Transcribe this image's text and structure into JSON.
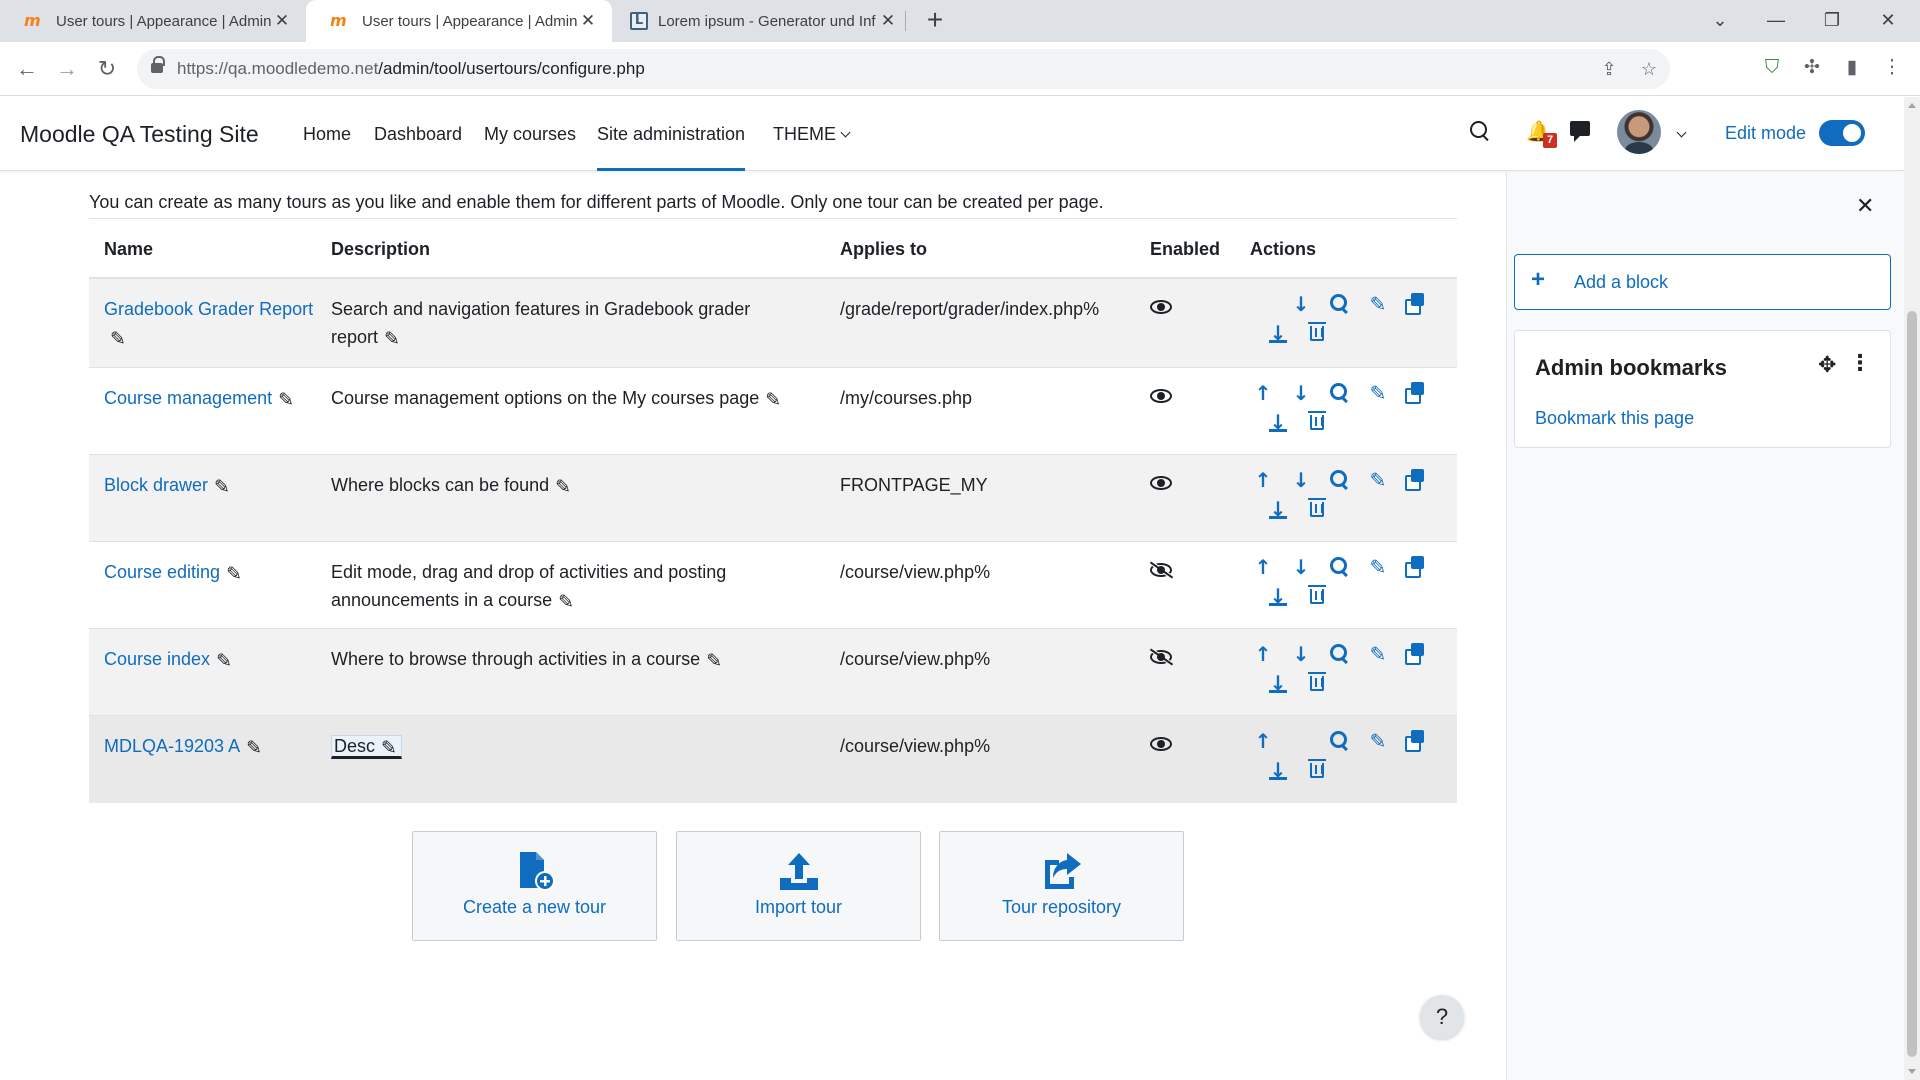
{
  "browser": {
    "tabs": [
      {
        "title": "User tours | Appearance | Admini",
        "favicon": "moodle-icon"
      },
      {
        "title": "User tours | Appearance | Admini",
        "favicon": "moodle-icon"
      },
      {
        "title": "Lorem ipsum - Generator und Inf",
        "favicon": "lorem-icon"
      }
    ],
    "url_host": "https://qa.moodledemo.net",
    "url_path": "/admin/tool/usertours/configure.php"
  },
  "navbar": {
    "site_name": "Moodle QA Testing Site",
    "items": [
      "Home",
      "Dashboard",
      "My courses",
      "Site administration",
      "THEME"
    ],
    "notification_count": "7",
    "edit_mode_label": "Edit mode"
  },
  "main": {
    "intro": "You can create as many tours as you like and enable them for different parts of Moodle. Only one tour can be created per page.",
    "columns": [
      "Name",
      "Description",
      "Applies to",
      "Enabled",
      "Actions"
    ],
    "tours": [
      {
        "name": "Gradebook Grader Report",
        "description": "Search and navigation features in Gradebook grader report",
        "applies_to": "/grade/report/grader/index.php%",
        "enabled": true
      },
      {
        "name": "Course management",
        "description": "Course management options on the My courses page",
        "applies_to": "/my/courses.php",
        "enabled": true
      },
      {
        "name": "Block drawer",
        "description": "Where blocks can be found",
        "applies_to": "FRONTPAGE_MY",
        "enabled": true
      },
      {
        "name": "Course editing",
        "description": "Edit mode, drag and drop of activities and posting announcements in a course",
        "applies_to": "/course/view.php%",
        "enabled": false
      },
      {
        "name": "Course index",
        "description": "Where to browse through activities in a course",
        "applies_to": "/course/view.php%",
        "enabled": false
      },
      {
        "name": "MDLQA-19203 A",
        "description": "Desc",
        "applies_to": "/course/view.php%",
        "enabled": true
      }
    ],
    "buttons": {
      "create": "Create a new tour",
      "import": "Import tour",
      "repository": "Tour repository"
    },
    "help_label": "?"
  },
  "drawer": {
    "add_block": "Add a block",
    "bookmarks_title": "Admin bookmarks",
    "bookmark_link": "Bookmark this page"
  },
  "colors": {
    "accent": "#0f6cbf",
    "text": "#1d2125",
    "badge": "#ca3120"
  }
}
